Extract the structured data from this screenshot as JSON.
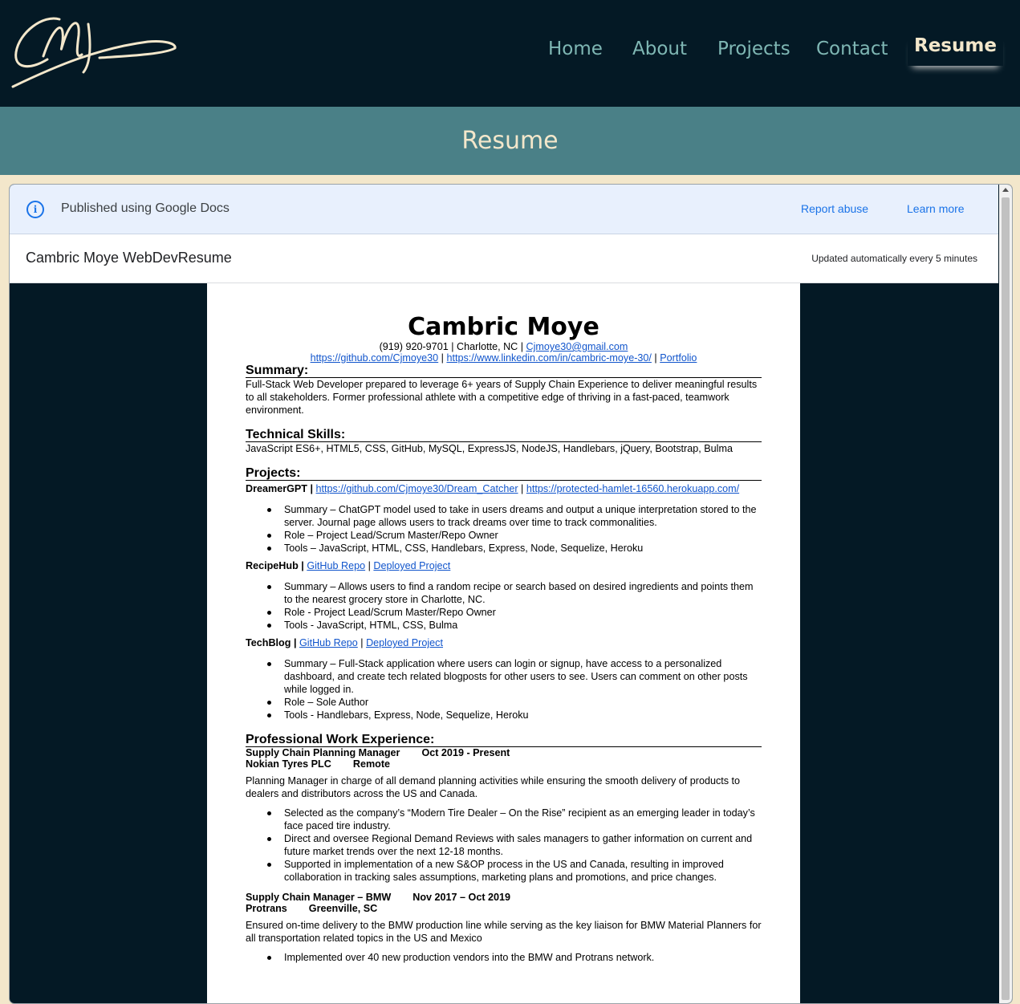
{
  "nav": {
    "logo": "CM",
    "items": [
      {
        "label": "Home"
      },
      {
        "label": "About"
      },
      {
        "label": "Projects"
      },
      {
        "label": "Contact"
      },
      {
        "label": "Resume"
      }
    ]
  },
  "banner": {
    "title": "Resume"
  },
  "gdocs": {
    "published": "Published using Google Docs",
    "report_abuse": "Report abuse",
    "learn_more": "Learn more",
    "doc_title": "Cambric Moye WebDevResume",
    "updated": "Updated automatically every 5 minutes"
  },
  "resume": {
    "name": "Cambric Moye",
    "contact_prefix": "(919) 920-9701 | Charlotte, NC | ",
    "email": "Cjmoye30@gmail.com",
    "github": "https://github.com/Cjmoye30",
    "linkedin": "https://www.linkedin.com/in/cambric-moye-30/",
    "portfolio": "Portfolio",
    "sep": " | ",
    "summary_heading": "Summary:",
    "summary": "Full-Stack Web Developer prepared to leverage 6+ years of Supply Chain Experience to deliver meaningful results to all stakeholders. Former professional athlete with a competitive edge of thriving in a fast-paced, teamwork environment.",
    "skills_heading": "Technical Skills:",
    "skills": "JavaScript ES6+, HTML5, CSS, GitHub, MySQL, ExpressJS, NodeJS, Handlebars, jQuery, Bootstrap, Bulma",
    "projects_heading": "Projects:",
    "projects": [
      {
        "name": "DreamerGPT",
        "link1": "https://github.com/Cjmoye30/Dream_Catcher",
        "link2": "https://protected-hamlet-16560.herokuapp.com/",
        "bullets": [
          "Summary – ChatGPT model used to take in users dreams and output a unique interpretation stored to the server. Journal page allows users to track dreams over time to track commonalities.",
          "Role – Project Lead/Scrum Master/Repo Owner",
          "Tools – JavaScript, HTML, CSS, Handlebars, Express, Node, Sequelize, Heroku"
        ]
      },
      {
        "name": "RecipeHub",
        "link1": "GitHub Repo",
        "link2": "Deployed Project",
        "bullets": [
          "Summary – Allows users to find a random recipe or search based on desired ingredients and points them to the nearest grocery store in Charlotte, NC.",
          "Role - Project Lead/Scrum Master/Repo Owner",
          "Tools - JavaScript, HTML, CSS, Bulma"
        ]
      },
      {
        "name": "TechBlog",
        "link1": "GitHub Repo",
        "link2": "Deployed Project",
        "bullets": [
          "Summary – Full-Stack application where users can login or signup, have access to a personalized dashboard, and create tech related blogposts for other users to see. Users can comment on other posts while logged in.",
          "Role – Sole Author",
          "Tools - Handlebars, Express, Node, Sequelize, Heroku"
        ]
      }
    ],
    "work_heading": "Professional Work Experience:",
    "jobs": [
      {
        "title": "Supply Chain Planning Manager",
        "dates": "Oct 2019 - Present",
        "company": "Nokian Tyres PLC",
        "location": "Remote",
        "desc": "Planning Manager in charge of all demand planning activities while ensuring the smooth delivery of products to dealers and distributors across the US and Canada.",
        "bullets": [
          "Selected as the company’s “Modern Tire Dealer – On the Rise” recipient as an emerging leader in today’s face paced tire industry.",
          "Direct and oversee Regional Demand Reviews with sales managers to gather information on current and future market trends over the next 12-18 months.",
          "Supported in implementation of a new S&OP process in the US and Canada, resulting in improved collaboration in tracking sales assumptions, marketing plans and promotions, and price changes."
        ]
      },
      {
        "title": "Supply Chain Manager – BMW",
        "dates": "Nov 2017 – Oct 2019",
        "company": "Protrans",
        "location": "Greenville, SC",
        "desc": "Ensured on-time delivery to the BMW production line while serving as the key liaison for BMW Material Planners for all transportation related topics in the US and Mexico",
        "bullets": [
          "Implemented over 40 new production vendors into the BMW and Protrans network."
        ]
      }
    ]
  }
}
